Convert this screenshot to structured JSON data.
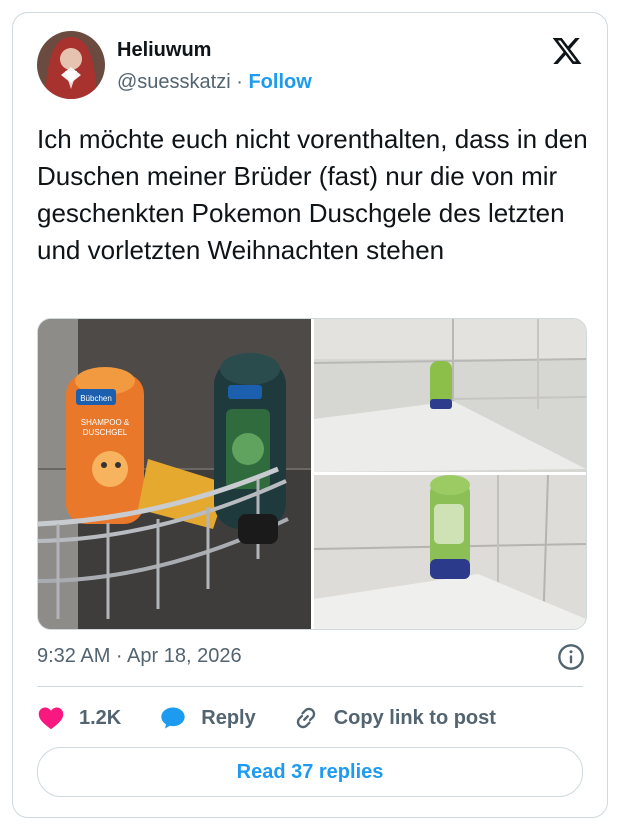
{
  "author": {
    "name": "Heliuwum",
    "handle": "@suesskatzi",
    "separator": " · ",
    "follow_label": "Follow"
  },
  "tweet": {
    "text": "Ich möchte euch nicht vorenthalten, dass in den Duschen meiner Brüder (fast) nur die von mir geschenkten Pokemon Duschgele des letzten und vorletzten Weihnachten stehen",
    "timestamp": "9:32 AM · Apr 18, 2026"
  },
  "actions": {
    "likes": "1.2K",
    "reply_label": "Reply",
    "copy_label": "Copy link to post",
    "read_replies_label": "Read 37 replies"
  },
  "media": {
    "bottle_brand": "Bübchen",
    "bottle_label_1": "SHAMPOO &",
    "bottle_label_2": "DUSCHGEL"
  },
  "icons": {
    "logo": "x-logo-icon",
    "info": "info-icon",
    "like": "heart-icon",
    "reply": "speech-bubble-icon",
    "copy": "link-icon"
  },
  "colors": {
    "accent": "#1d9bf0",
    "like": "#f91880",
    "muted": "#536471",
    "border": "#cfd9de"
  }
}
